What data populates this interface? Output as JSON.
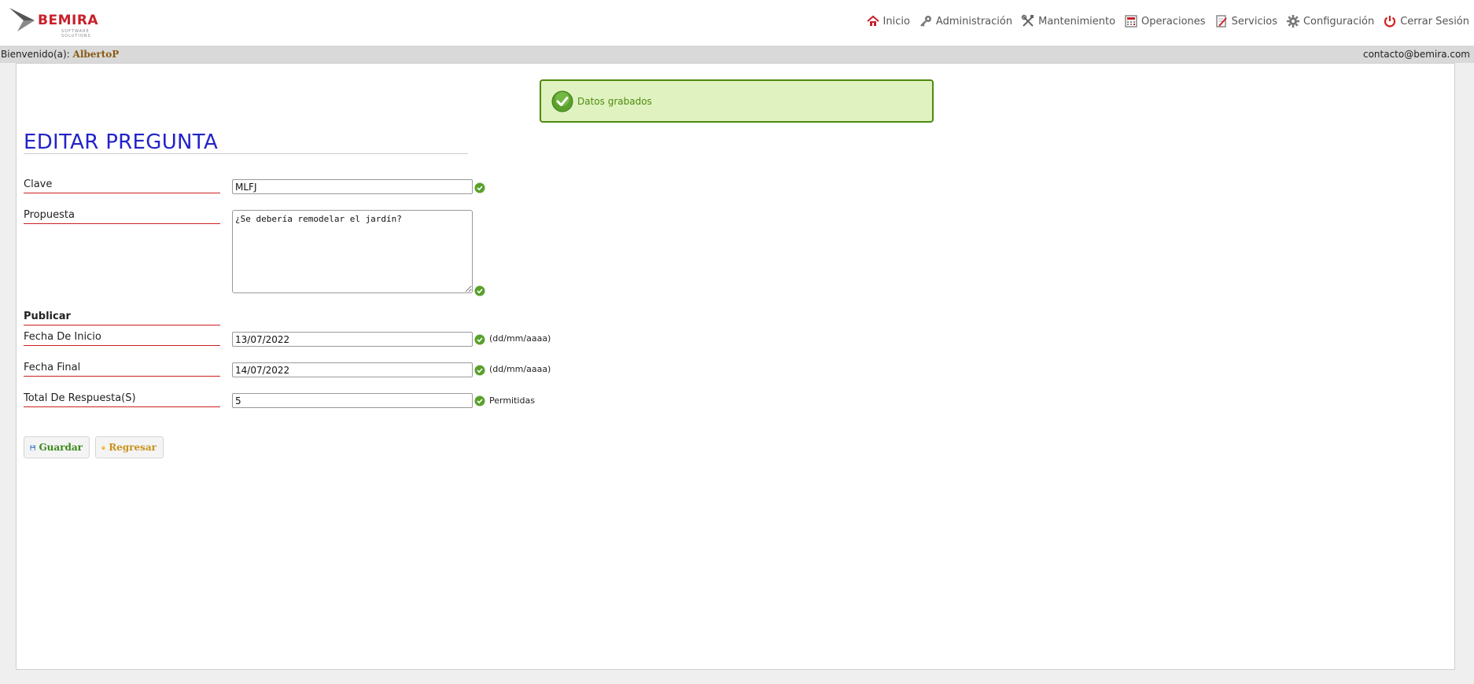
{
  "header": {
    "logo_text": "BEMIRA",
    "logo_subtext": "SOFTWARE SOLUTIONS",
    "nav": [
      {
        "label": "Inicio",
        "icon": "home-icon"
      },
      {
        "label": "Administración",
        "icon": "key-icon"
      },
      {
        "label": "Mantenimiento",
        "icon": "tools-icon"
      },
      {
        "label": "Operaciones",
        "icon": "calculator-icon"
      },
      {
        "label": "Servicios",
        "icon": "document-edit-icon"
      },
      {
        "label": "Configuración",
        "icon": "gear-icon"
      },
      {
        "label": "Cerrar Sesión",
        "icon": "power-icon"
      }
    ]
  },
  "welcome": {
    "prefix": "Bienvenido(a):",
    "username": "AlbertoP",
    "contact": "contacto@bemira.com"
  },
  "alert": {
    "message": "Datos grabados",
    "icon": "success-check-icon",
    "color": "#4f8a10",
    "background": "#dff2bf"
  },
  "form": {
    "title": "EDITAR PREGUNTA",
    "clave": {
      "label": "Clave",
      "value": "MLFJ"
    },
    "propuesta": {
      "label": "Propuesta",
      "value": "¿Se debería remodelar el jardín?"
    },
    "publicar": {
      "label": "Publicar"
    },
    "fecha_inicio": {
      "label": "Fecha De Inicio",
      "value": "13/07/2022",
      "hint": "(dd/mm/aaaa)"
    },
    "fecha_final": {
      "label": "Fecha Final",
      "value": "14/07/2022",
      "hint": "(dd/mm/aaaa)"
    },
    "total_respuestas": {
      "label": "Total De Respuesta(S)",
      "value": "5",
      "hint": "Permitidas"
    }
  },
  "buttons": {
    "save": "Guardar",
    "back": "Regresar"
  },
  "colors": {
    "title": "#2323c8",
    "label_underline": "#cc1f1f",
    "brand": "#c8202b",
    "save_text": "#3a8a1a",
    "back_text": "#c8921a"
  }
}
